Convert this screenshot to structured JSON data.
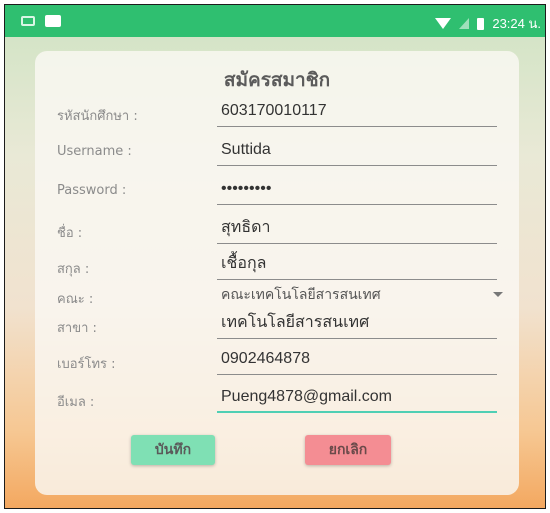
{
  "status_bar": {
    "time": "23:24 น.",
    "icons": [
      "notification-icon",
      "image-icon",
      "wifi-icon",
      "signal-icon",
      "battery-icon"
    ]
  },
  "form": {
    "title": "สมัครสมาชิก",
    "fields": [
      {
        "label": "รหัสนักศึกษา :",
        "value": "603170010117"
      },
      {
        "label": "Username :",
        "value": "Suttida"
      },
      {
        "label": "Password :",
        "value": "•••••••••"
      },
      {
        "label": "ชื่อ :",
        "value": "สุทธิดา"
      },
      {
        "label": "สกุล :",
        "value": "เชื้อกุล"
      },
      {
        "label": "คณะ :",
        "value": "คณะเทคโนโลยีสารสนเทศ"
      },
      {
        "label": "สาขา :",
        "value": "เทคโนโลยีสารสนเทศ"
      },
      {
        "label": "เบอร์โทร :",
        "value": "0902464878"
      },
      {
        "label": "อีเมล :",
        "value": "Pueng4878@gmail.com"
      }
    ],
    "save_label": "บันทึก",
    "cancel_label": "ยกเลิก"
  },
  "colors": {
    "status_bar": "#2fbf70",
    "save_button": "#7fe0b4",
    "cancel_button": "#f48d93",
    "active_underline": "#4fcfb4"
  }
}
